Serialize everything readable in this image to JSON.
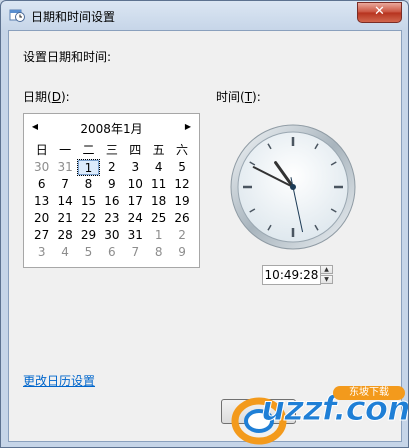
{
  "window": {
    "title": "日期和时间设置",
    "close_glyph": "✕"
  },
  "heading": "设置日期和时间:",
  "date": {
    "label_pre": "日期(",
    "label_key": "D",
    "label_post": "):"
  },
  "time": {
    "label_pre": "时间(",
    "label_key": "T",
    "label_post": "):",
    "value": "10:49:28",
    "up": "▲",
    "down": "▼",
    "clock": {
      "hours": 10,
      "minutes": 49,
      "seconds": 28
    }
  },
  "calendar": {
    "title": "2008年1月",
    "prev": "◀",
    "next": "▶",
    "weekdays": [
      "日",
      "一",
      "二",
      "三",
      "四",
      "五",
      "六"
    ],
    "weeks": [
      [
        {
          "d": "30",
          "g": true
        },
        {
          "d": "31",
          "g": true
        },
        {
          "d": "1",
          "t": true
        },
        {
          "d": "2"
        },
        {
          "d": "3"
        },
        {
          "d": "4"
        },
        {
          "d": "5"
        }
      ],
      [
        {
          "d": "6"
        },
        {
          "d": "7"
        },
        {
          "d": "8"
        },
        {
          "d": "9"
        },
        {
          "d": "10"
        },
        {
          "d": "11"
        },
        {
          "d": "12"
        }
      ],
      [
        {
          "d": "13"
        },
        {
          "d": "14"
        },
        {
          "d": "15"
        },
        {
          "d": "16"
        },
        {
          "d": "17"
        },
        {
          "d": "18"
        },
        {
          "d": "19"
        }
      ],
      [
        {
          "d": "20"
        },
        {
          "d": "21"
        },
        {
          "d": "22"
        },
        {
          "d": "23"
        },
        {
          "d": "24"
        },
        {
          "d": "25"
        },
        {
          "d": "26"
        }
      ],
      [
        {
          "d": "27"
        },
        {
          "d": "28"
        },
        {
          "d": "29"
        },
        {
          "d": "30"
        },
        {
          "d": "31"
        },
        {
          "d": "1",
          "g": true
        },
        {
          "d": "2",
          "g": true
        }
      ],
      [
        {
          "d": "3",
          "g": true
        },
        {
          "d": "4",
          "g": true
        },
        {
          "d": "5",
          "g": true
        },
        {
          "d": "6",
          "g": true
        },
        {
          "d": "7",
          "g": true
        },
        {
          "d": "8",
          "g": true
        },
        {
          "d": "9",
          "g": true
        }
      ]
    ]
  },
  "link": "更改日历设置",
  "watermark": {
    "text": "uzzf.com",
    "badge": "东坡下载"
  },
  "icons": {
    "title": "clock-calendar-icon"
  }
}
